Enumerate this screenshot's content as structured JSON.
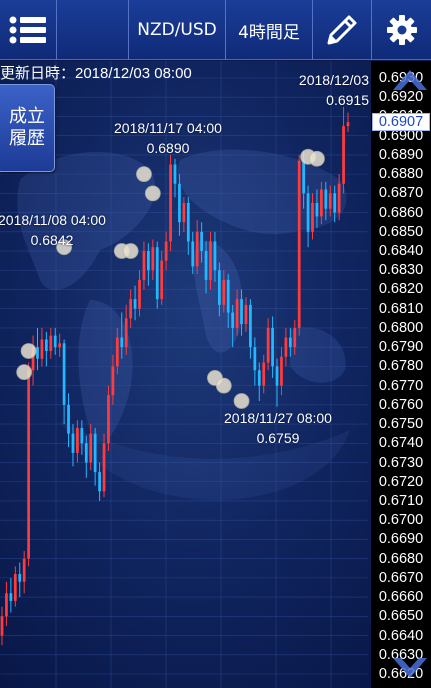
{
  "toolbar": {
    "menu_icon": "list-menu-icon",
    "symbol": "NZD/USD",
    "timeframe": "4時間足",
    "draw_icon": "pencil-icon",
    "settings_icon": "gear-icon"
  },
  "updated_label": "更新日時：2018/12/03 08:00",
  "history_button_label": "成立履歴",
  "current_price": "0.6907",
  "annotations": [
    {
      "date": "2018/12/03",
      "price": "0.6915"
    },
    {
      "date": "2018/11/17 04:00",
      "price": "0.6890"
    },
    {
      "date": "2018/11/08 04:00",
      "price": "0.6842"
    },
    {
      "date": "2018/11/27 08:00",
      "price": "0.6759"
    }
  ],
  "colors": {
    "bull_candle": "#ff3b3b",
    "bear_candle": "#22b8ff",
    "toolbar_bg": "#183a92",
    "chart_bg": "#0c1a4a",
    "trade_marker": "#e8e2d0"
  },
  "chart_data": {
    "type": "candlestick",
    "y_axis_side": "right",
    "ylim": [
      0.6618,
      0.6938
    ],
    "y_ticks": [
      "0.6930",
      "0.6920",
      "0.6910",
      "0.6900",
      "0.6890",
      "0.6880",
      "0.6870",
      "0.6860",
      "0.6850",
      "0.6840",
      "0.6830",
      "0.6820",
      "0.6810",
      "0.6800",
      "0.6790",
      "0.6780",
      "0.6770",
      "0.6760",
      "0.6750",
      "0.6740",
      "0.6730",
      "0.6720",
      "0.6710",
      "0.6700",
      "0.6690",
      "0.6680",
      "0.6670",
      "0.6660",
      "0.6650",
      "0.6640",
      "0.6630",
      "0.6620"
    ],
    "grid": true,
    "candles": [
      [
        0.664,
        0.665,
        0.6635,
        0.6655
      ],
      [
        0.665,
        0.6662,
        0.6645,
        0.6668
      ],
      [
        0.6662,
        0.6658,
        0.6652,
        0.667
      ],
      [
        0.6658,
        0.6672,
        0.6655,
        0.6676
      ],
      [
        0.6672,
        0.6668,
        0.666,
        0.6678
      ],
      [
        0.6668,
        0.668,
        0.6662,
        0.6684
      ],
      [
        0.668,
        0.6778,
        0.6676,
        0.6782
      ],
      [
        0.6778,
        0.679,
        0.677,
        0.6796
      ],
      [
        0.679,
        0.6784,
        0.6778,
        0.68
      ],
      [
        0.6784,
        0.6794,
        0.678,
        0.68
      ],
      [
        0.6794,
        0.6788,
        0.678,
        0.6798
      ],
      [
        0.6788,
        0.6796,
        0.6784,
        0.68
      ],
      [
        0.6796,
        0.679,
        0.6786,
        0.68
      ],
      [
        0.679,
        0.6792,
        0.6785,
        0.6797
      ],
      [
        0.6792,
        0.676,
        0.675,
        0.6794
      ],
      [
        0.676,
        0.6745,
        0.6738,
        0.6766
      ],
      [
        0.6745,
        0.6735,
        0.6728,
        0.675
      ],
      [
        0.6735,
        0.6748,
        0.673,
        0.6752
      ],
      [
        0.6748,
        0.674,
        0.6734,
        0.6752
      ],
      [
        0.674,
        0.673,
        0.6722,
        0.6744
      ],
      [
        0.673,
        0.6745,
        0.6726,
        0.675
      ],
      [
        0.6745,
        0.6725,
        0.6718,
        0.6748
      ],
      [
        0.6725,
        0.6715,
        0.671,
        0.673
      ],
      [
        0.6715,
        0.674,
        0.6712,
        0.6745
      ],
      [
        0.674,
        0.6765,
        0.6736,
        0.677
      ],
      [
        0.6765,
        0.678,
        0.676,
        0.6786
      ],
      [
        0.678,
        0.6795,
        0.6776,
        0.68
      ],
      [
        0.6795,
        0.679,
        0.6784,
        0.6808
      ],
      [
        0.679,
        0.6805,
        0.6786,
        0.6812
      ],
      [
        0.6805,
        0.6815,
        0.68,
        0.682
      ],
      [
        0.6815,
        0.681,
        0.6804,
        0.6822
      ],
      [
        0.681,
        0.6825,
        0.6806,
        0.683
      ],
      [
        0.6825,
        0.684,
        0.682,
        0.6845
      ],
      [
        0.684,
        0.683,
        0.6822,
        0.6844
      ],
      [
        0.683,
        0.6842,
        0.6825,
        0.6846
      ],
      [
        0.6842,
        0.6815,
        0.681,
        0.6845
      ],
      [
        0.6815,
        0.6835,
        0.6812,
        0.684
      ],
      [
        0.6835,
        0.6845,
        0.683,
        0.685
      ],
      [
        0.6845,
        0.6885,
        0.684,
        0.689
      ],
      [
        0.6885,
        0.6875,
        0.6868,
        0.6888
      ],
      [
        0.6875,
        0.6855,
        0.6848,
        0.688
      ],
      [
        0.6855,
        0.6865,
        0.685,
        0.6868
      ],
      [
        0.6865,
        0.6845,
        0.6838,
        0.6868
      ],
      [
        0.6845,
        0.6832,
        0.6828,
        0.685
      ],
      [
        0.6832,
        0.685,
        0.6828,
        0.6856
      ],
      [
        0.685,
        0.684,
        0.6834,
        0.6855
      ],
      [
        0.684,
        0.6825,
        0.6818,
        0.6845
      ],
      [
        0.6825,
        0.6845,
        0.682,
        0.685
      ],
      [
        0.6845,
        0.683,
        0.6824,
        0.685
      ],
      [
        0.683,
        0.6812,
        0.6806,
        0.6834
      ],
      [
        0.6812,
        0.6825,
        0.6808,
        0.683
      ],
      [
        0.6825,
        0.6808,
        0.68,
        0.6828
      ],
      [
        0.6808,
        0.68,
        0.679,
        0.6812
      ],
      [
        0.68,
        0.6815,
        0.6796,
        0.682
      ],
      [
        0.6815,
        0.6802,
        0.6796,
        0.682
      ],
      [
        0.6802,
        0.6812,
        0.6798,
        0.6816
      ],
      [
        0.6812,
        0.679,
        0.6784,
        0.6815
      ],
      [
        0.679,
        0.6778,
        0.677,
        0.6795
      ],
      [
        0.6778,
        0.677,
        0.6762,
        0.6782
      ],
      [
        0.677,
        0.6782,
        0.6766,
        0.6786
      ],
      [
        0.6782,
        0.68,
        0.6778,
        0.6805
      ],
      [
        0.68,
        0.678,
        0.6774,
        0.6806
      ],
      [
        0.678,
        0.677,
        0.6759,
        0.6784
      ],
      [
        0.677,
        0.6785,
        0.6765,
        0.679
      ],
      [
        0.6785,
        0.6795,
        0.678,
        0.68
      ],
      [
        0.6795,
        0.679,
        0.6785,
        0.68
      ],
      [
        0.679,
        0.68,
        0.6786,
        0.6804
      ],
      [
        0.68,
        0.6887,
        0.6796,
        0.689
      ],
      [
        0.6887,
        0.687,
        0.6862,
        0.6892
      ],
      [
        0.687,
        0.685,
        0.6842,
        0.6874
      ],
      [
        0.685,
        0.6865,
        0.6846,
        0.687
      ],
      [
        0.6865,
        0.6858,
        0.6852,
        0.6872
      ],
      [
        0.6858,
        0.6872,
        0.6854,
        0.6876
      ],
      [
        0.6872,
        0.6862,
        0.6856,
        0.6876
      ],
      [
        0.6862,
        0.687,
        0.6858,
        0.6874
      ],
      [
        0.687,
        0.686,
        0.6855,
        0.6874
      ],
      [
        0.686,
        0.6875,
        0.6856,
        0.688
      ],
      [
        0.6875,
        0.6905,
        0.687,
        0.6915
      ],
      [
        0.6905,
        0.6907,
        0.6902,
        0.6912
      ]
    ],
    "trade_markers": [
      [
        5,
        0.6777
      ],
      [
        6,
        0.6788
      ],
      [
        14,
        0.6842
      ],
      [
        27,
        0.684
      ],
      [
        29,
        0.684
      ],
      [
        32,
        0.688
      ],
      [
        34,
        0.687
      ],
      [
        48,
        0.6774
      ],
      [
        50,
        0.677
      ],
      [
        54,
        0.6762
      ],
      [
        69,
        0.6889
      ],
      [
        71,
        0.6888
      ]
    ]
  }
}
